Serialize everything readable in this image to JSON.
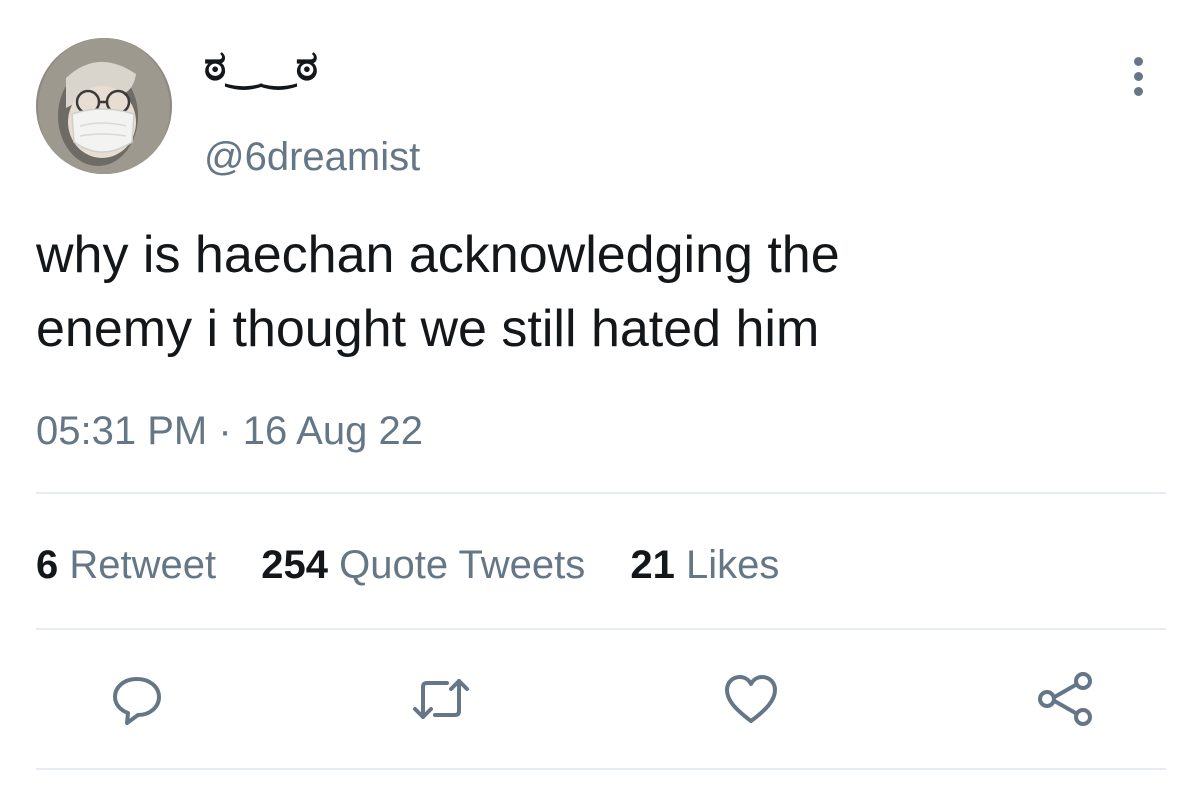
{
  "tweet": {
    "display_name": "ಠ‿‿ಠ",
    "handle": "@6dreamist",
    "text_lines": [
      "why is haechan acknowledging the",
      "enemy i thought we still hated him"
    ],
    "timestamp": "05:31 PM · 16 Aug 22"
  },
  "stats": {
    "retweets": {
      "count": "6",
      "label": "Retweet"
    },
    "quotes": {
      "count": "254",
      "label": "Quote Tweets"
    },
    "likes": {
      "count": "21",
      "label": "Likes"
    }
  },
  "actions": {
    "reply_icon": "reply-icon",
    "retweet_icon": "retweet-icon",
    "like_icon": "heart-icon",
    "share_icon": "share-icon"
  },
  "colors": {
    "text_primary": "#14171a",
    "text_secondary": "#657786",
    "divider": "#e6ecf0",
    "icon": "#657786"
  }
}
